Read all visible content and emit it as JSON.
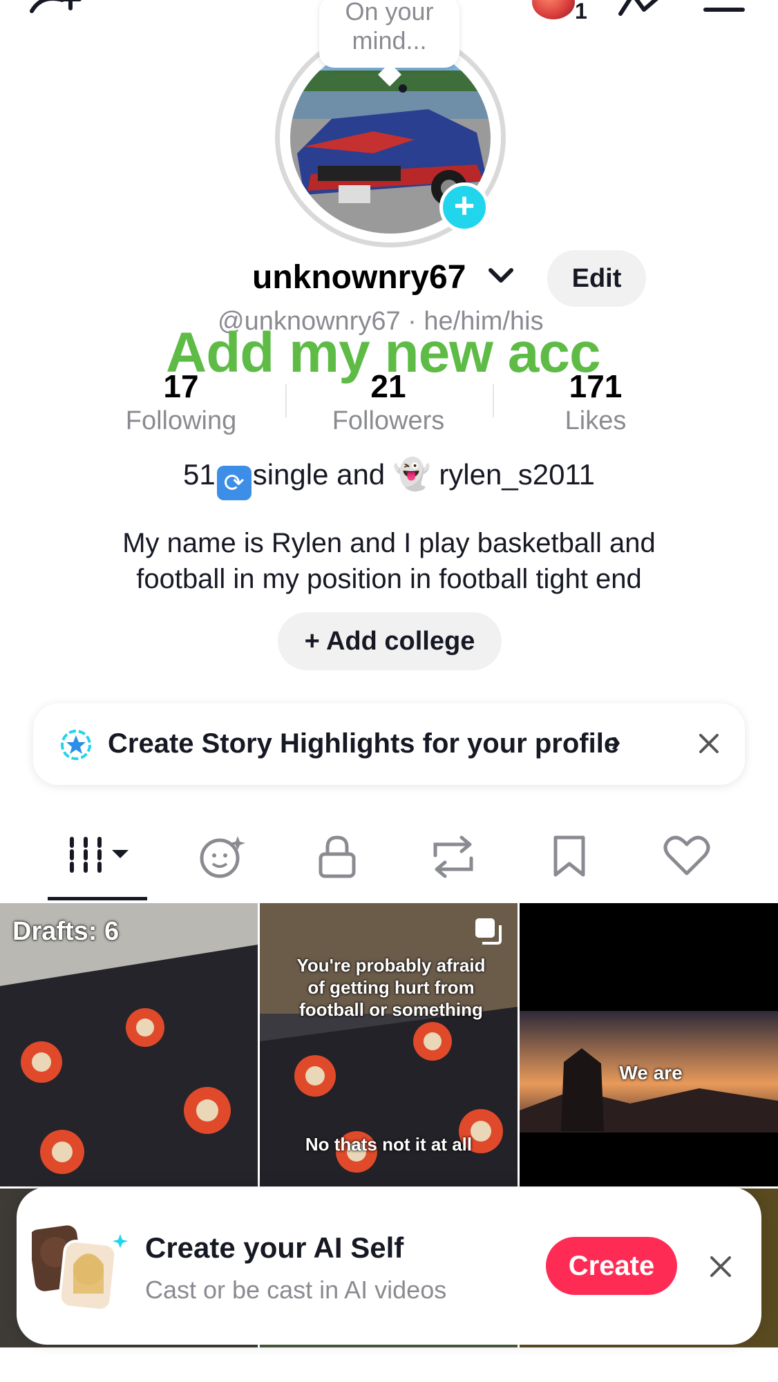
{
  "header": {
    "notification_count": "1"
  },
  "avatar": {
    "bubble_text": "On your mind..."
  },
  "profile": {
    "username": "unknownry67",
    "edit_label": "Edit",
    "handle_line": "@unknownry67 · he/him/his",
    "overlay_text": "Add  my new acc"
  },
  "stats": [
    {
      "value": "17",
      "label": "Following"
    },
    {
      "value": "21",
      "label": "Followers"
    },
    {
      "value": "171",
      "label": "Likes"
    }
  ],
  "bio": {
    "line1_prefix": "51",
    "line1_middle": "single and",
    "line1_suffix": "rylen_s2011",
    "description": "My name is Rylen and I play basketball and football in my position in football  tight end"
  },
  "college_button": "+ Add college",
  "highlights_banner": {
    "text": "Create Story Highlights for your profile",
    "chevron": "›"
  },
  "tabs": [
    {
      "name": "videos",
      "icon": "grid-icon",
      "selected": true
    },
    {
      "name": "ai-self",
      "icon": "ai-face-icon"
    },
    {
      "name": "private",
      "icon": "lock-icon"
    },
    {
      "name": "reposts",
      "icon": "repost-icon"
    },
    {
      "name": "favorites",
      "icon": "bookmark-icon"
    },
    {
      "name": "liked",
      "icon": "heart-icon"
    }
  ],
  "grid": {
    "drafts_label": "Drafts: 6",
    "cell2_top_caption": "You're probably afraid of getting hurt from football or something",
    "cell2_bottom_caption": "No thats not it at all",
    "cell3_caption": "We are"
  },
  "ai_card": {
    "title": "Create your AI Self",
    "subtitle": "Cast or be cast in AI videos",
    "create_label": "Create"
  },
  "colors": {
    "accent_red": "#fe2c55",
    "accent_cyan": "#20d5ec",
    "overlay_green": "#5dbb46"
  }
}
